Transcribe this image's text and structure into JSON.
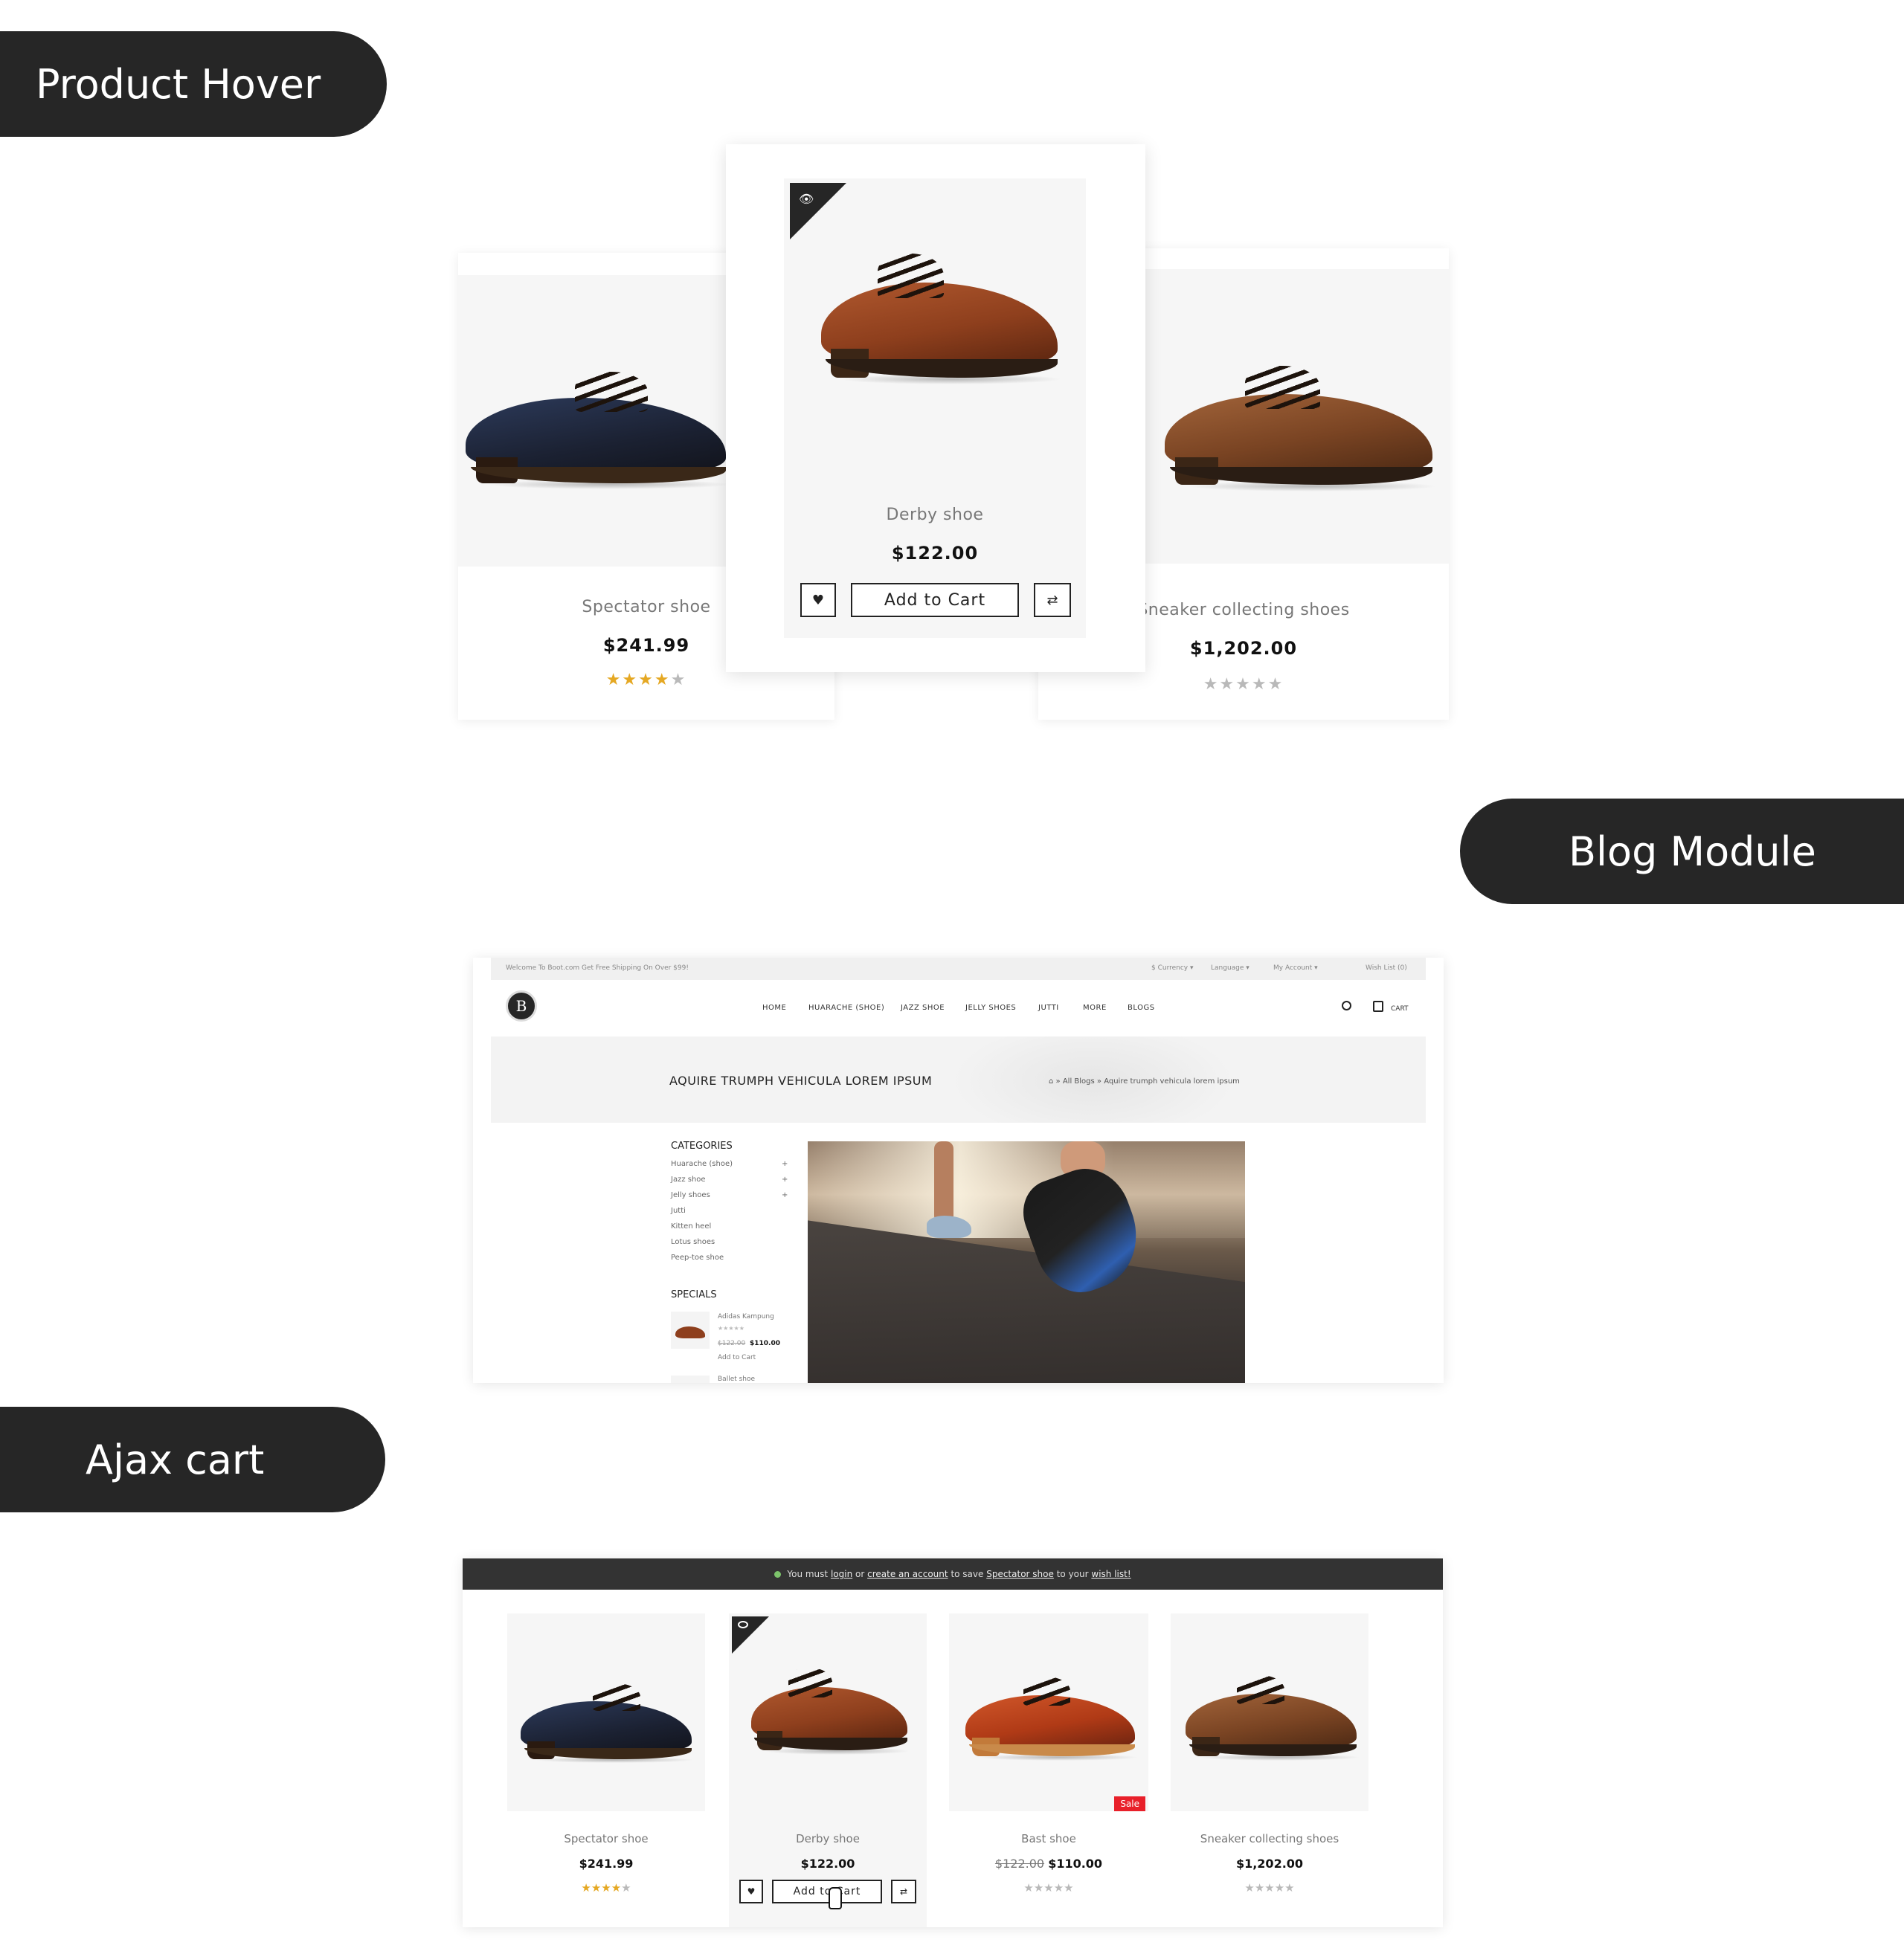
{
  "sections": {
    "product_hover": "Product Hover",
    "blog_module": "Blog Module",
    "ajax_cart": "Ajax cart"
  },
  "hover": {
    "left": {
      "name": "Spectator shoe",
      "price": "$241.99",
      "stars": "★★★★",
      "stars_off": "★"
    },
    "center": {
      "name": "Derby shoe",
      "price": "$122.00",
      "add_to_cart": "Add to Cart",
      "wishlist_icon": "♥",
      "compare_icon": "⇄",
      "eye_icon": "👁"
    },
    "right": {
      "name": "Sneaker collecting shoes",
      "price": "$1,202.00",
      "stars_off": "★★★★★"
    }
  },
  "blog": {
    "top_left": "Welcome To Boot.com Get Free Shipping On Over $99!",
    "currency": "$ Currency ▾",
    "language": "Language ▾",
    "account": "My Account ▾",
    "wishlist": "Wish List (0)",
    "logo": "B",
    "nav": [
      "HOME",
      "HUARACHE (SHOE)",
      "JAZZ SHOE",
      "JELLY SHOES",
      "JUTTI",
      "MORE",
      "BLOGS"
    ],
    "cart": "CART",
    "banner_title": "AQUIRE TRUMPH VEHICULA LOREM IPSUM",
    "breadcrumb": "⌂  »  All Blogs  »  Aquire trumph vehicula lorem ipsum",
    "categories_title": "CATEGORIES",
    "categories": [
      "Huarache (shoe)",
      "Jazz shoe",
      "Jelly shoes",
      "Jutti",
      "Kitten heel",
      "Lotus shoes",
      "Peep-toe shoe"
    ],
    "specials_title": "SPECIALS",
    "special_item": {
      "name": "Adidas Kampung",
      "old_price": "$122.00",
      "price": "$110.00",
      "action": "Add to Cart",
      "stars": "★★★★★"
    },
    "next_item": "Ballet shoe"
  },
  "ajax": {
    "notice_pre": "You must",
    "notice_login": "login",
    "notice_or": "or",
    "notice_create": "create an account",
    "notice_mid": "to save",
    "notice_product": "Spectator shoe",
    "notice_to": "to your",
    "notice_wishlist": "wish list!",
    "products": [
      {
        "name": "Spectator shoe",
        "price": "$241.99",
        "stars_on": "★★★★",
        "stars_off": "★"
      },
      {
        "name": "Derby shoe",
        "price": "$122.00",
        "add_to_cart": "Add to Cart"
      },
      {
        "name": "Bast shoe",
        "old_price": "$122.00",
        "price": "$110.00",
        "badge": "Sale",
        "stars_off": "★★★★★"
      },
      {
        "name": "Sneaker collecting shoes",
        "price": "$1,202.00",
        "stars_off": "★★★★★"
      }
    ]
  },
  "colors": {
    "dark": "#262626",
    "star": "#e5a823",
    "sale": "#e8202a"
  }
}
